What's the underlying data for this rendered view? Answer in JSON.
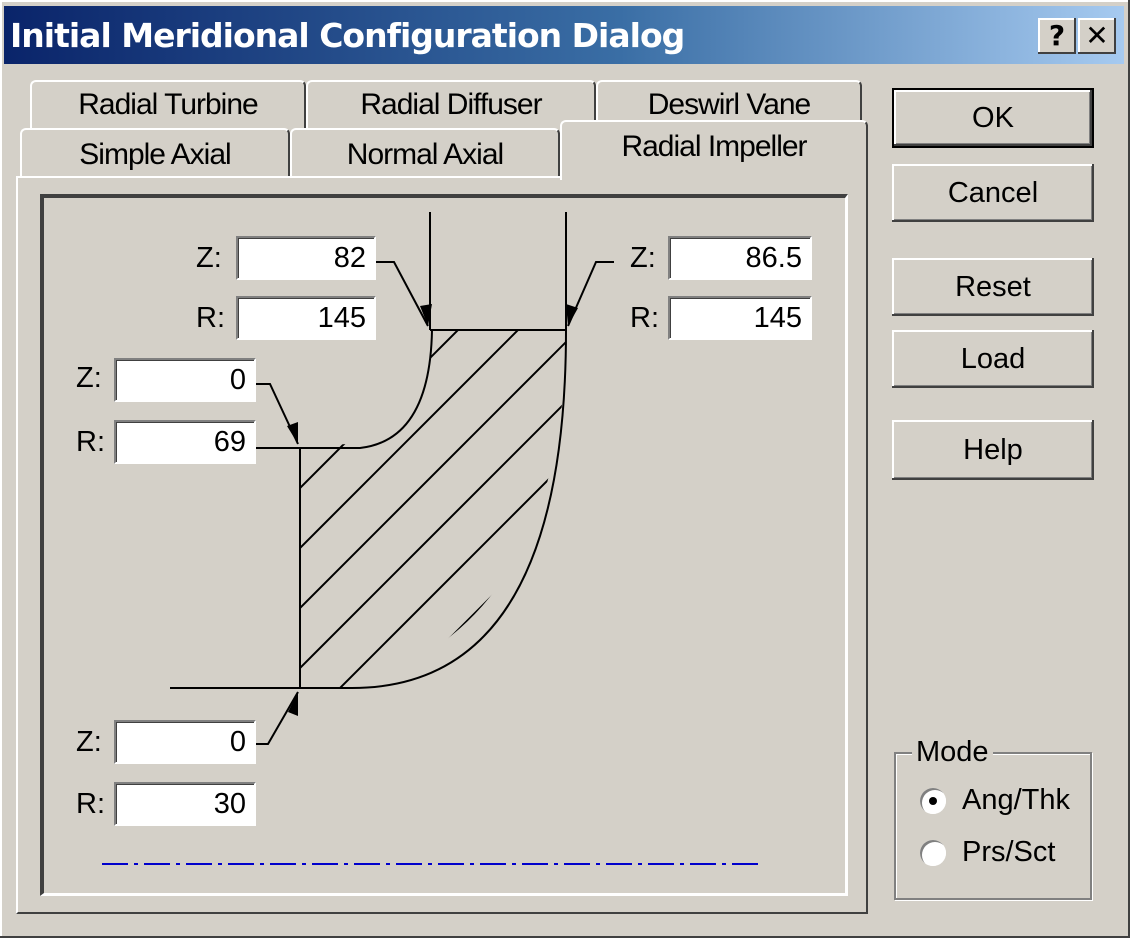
{
  "window": {
    "title": "Initial Meridional Configuration Dialog",
    "help_glyph": "?",
    "close_glyph": "✕"
  },
  "tabs": {
    "back_row": [
      "Radial Turbine",
      "Radial Diffuser",
      "Deswirl Vane"
    ],
    "front_row": [
      "Simple Axial",
      "Normal Axial",
      "Radial Impeller"
    ],
    "active": "Radial Impeller"
  },
  "fields": {
    "shroud_inlet_hub": {
      "z_label": "Z:",
      "z": "82",
      "r_label": "R:",
      "r": "145"
    },
    "shroud_inlet_tip": {
      "z_label": "Z:",
      "z": "86.5",
      "r_label": "R:",
      "r": "145"
    },
    "hub_exit": {
      "z_label": "Z:",
      "z": "0",
      "r_label": "R:",
      "r": "69"
    },
    "hub_inlet": {
      "z_label": "Z:",
      "z": "0",
      "r_label": "R:",
      "r": "30"
    }
  },
  "buttons": {
    "ok": "OK",
    "cancel": "Cancel",
    "reset": "Reset",
    "load": "Load",
    "help": "Help"
  },
  "mode": {
    "title": "Mode",
    "options": [
      {
        "label": "Ang/Thk",
        "checked": true
      },
      {
        "label": "Prs/Sct",
        "checked": false
      }
    ]
  },
  "colors": {
    "titlebar_start": "#0a246a",
    "titlebar_end": "#a6caf0",
    "axis_line": "#0000cc",
    "face": "#d4d0c8"
  }
}
